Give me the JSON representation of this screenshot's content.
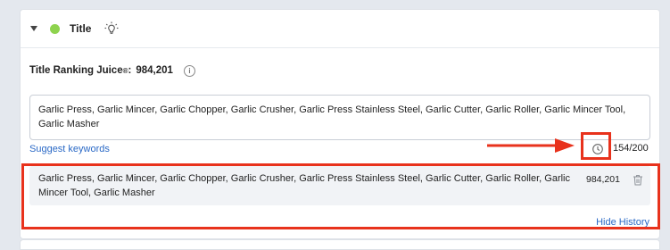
{
  "header": {
    "title": "Title",
    "icons": {
      "toggle": "chevron-down-icon",
      "status": "status-dot-icon",
      "tip": "lightbulb-icon"
    },
    "status_color": "#8ed34e"
  },
  "juice": {
    "label": "Title Ranking Juice",
    "mark": "®",
    "colon": ":",
    "value": "984,201",
    "info_icon": "info-icon"
  },
  "editor": {
    "value": "Garlic Press, Garlic Mincer, Garlic Chopper, Garlic Crusher, Garlic Press Stainless Steel, Garlic Cutter, Garlic Roller, Garlic Mincer Tool, Garlic Masher"
  },
  "suggest_label": "Suggest keywords",
  "counter": "154/200",
  "history": {
    "items": [
      {
        "text": "Garlic Press, Garlic Mincer, Garlic Chopper, Garlic Crusher, Garlic Press Stainless Steel, Garlic Cutter, Garlic Roller, Garlic Mincer Tool, Garlic Masher",
        "score": "984,201"
      }
    ],
    "hide_label": "Hide History"
  },
  "colors": {
    "accent": "#2a69c6",
    "annotation": "#e8321c"
  }
}
